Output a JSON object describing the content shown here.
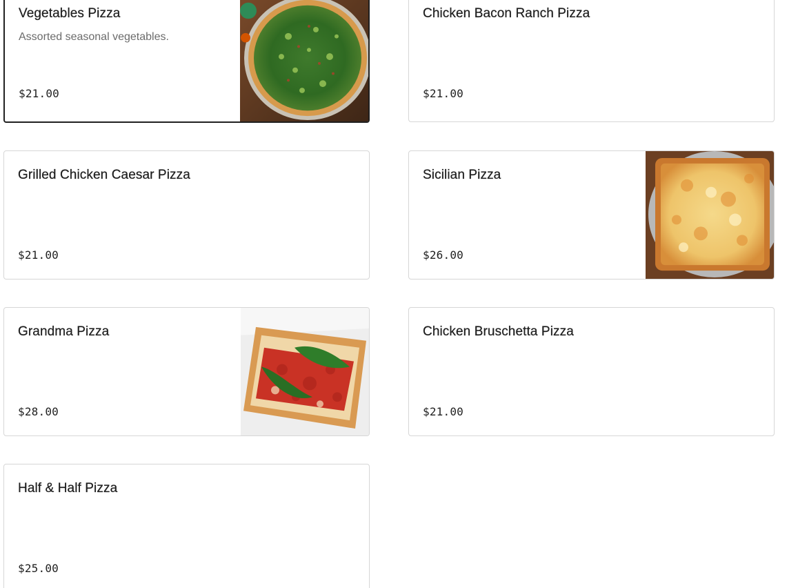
{
  "menu": {
    "items": [
      {
        "name": "Vegetables Pizza",
        "description": "Assorted seasonal vegetables.",
        "price": "$21.00",
        "image": "vegetable-pizza-photo",
        "selected": true
      },
      {
        "name": "Chicken Bacon Ranch Pizza",
        "description": "",
        "price": "$21.00",
        "image": null
      },
      {
        "name": "Grilled Chicken Caesar Pizza",
        "description": "",
        "price": "$21.00",
        "image": null
      },
      {
        "name": "Sicilian Pizza",
        "description": "",
        "price": "$26.00",
        "image": "sicilian-pizza-photo"
      },
      {
        "name": "Grandma Pizza",
        "description": "",
        "price": "$28.00",
        "image": "grandma-pizza-photo"
      },
      {
        "name": "Chicken Bruschetta Pizza",
        "description": "",
        "price": "$21.00",
        "image": null
      },
      {
        "name": "Half & Half Pizza",
        "description": "",
        "price": "$25.00",
        "image": null
      }
    ]
  }
}
